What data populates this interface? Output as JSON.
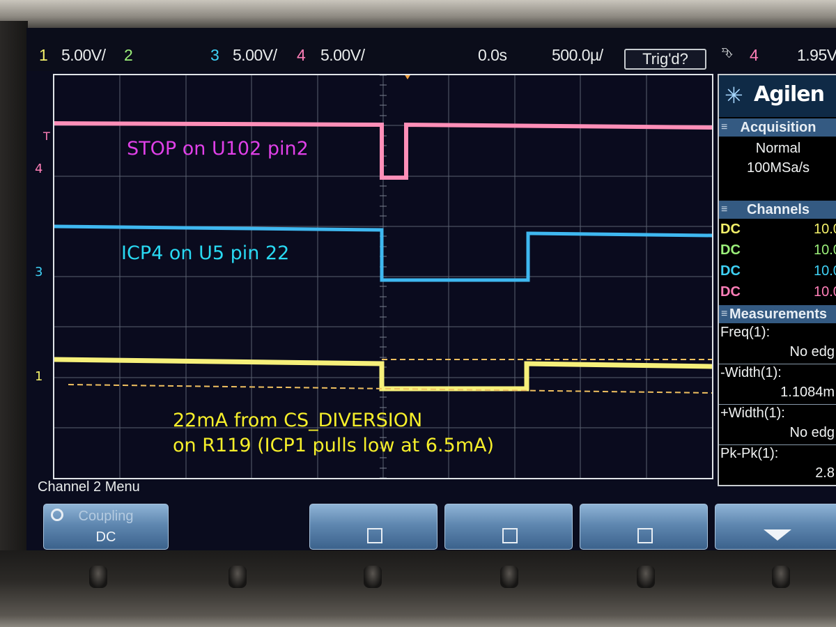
{
  "status_bar": {
    "ch1_num": "1",
    "ch1_scale": "5.00V/",
    "ch2_num": "2",
    "ch3_num": "3",
    "ch3_scale": "5.00V/",
    "ch4_num": "4",
    "ch4_scale": "5.00V/",
    "time_delay": "0.0s",
    "time_scale": "500.0µ/",
    "trigger_status": "Trig'd?",
    "trigger_source": "4",
    "trigger_level": "1.95V"
  },
  "traces": {
    "ch4_label": "4",
    "ch3_label": "3",
    "ch1_label": "1",
    "trigger_marker": "T"
  },
  "annotations": {
    "stop": "STOP on U102 pin2",
    "icp4": "ICP4 on U5 pin 22",
    "current_line1": "22mA from CS_DIVERSION",
    "current_line2": "on R119 (ICP1 pulls low at 6.5mA)"
  },
  "side_panel": {
    "brand": "Agilen",
    "acquisition_header": "Acquisition",
    "acquisition_mode": "Normal",
    "sample_rate": "100MSa/s",
    "channels_header": "Channels",
    "channels": [
      {
        "coupling": "DC",
        "scale": "10.0",
        "color": "#f4f16a"
      },
      {
        "coupling": "DC",
        "scale": "10.0",
        "color": "#9cf07a"
      },
      {
        "coupling": "DC",
        "scale": "10.0",
        "color": "#3fd1f5"
      },
      {
        "coupling": "DC",
        "scale": "10.0",
        "color": "#ff7fb8"
      }
    ],
    "measurements_header": "Measurements",
    "measurements": [
      {
        "label": "Freq(1):",
        "value": "No edg"
      },
      {
        "label": "-Width(1):",
        "value": "1.1084m"
      },
      {
        "label": "+Width(1):",
        "value": "No edg"
      },
      {
        "label": "Pk-Pk(1):",
        "value": "2.8"
      }
    ]
  },
  "menu": {
    "title": "Channel 2 Menu",
    "coupling_label": "Coupling",
    "coupling_value": "DC"
  },
  "colors": {
    "ch1": "#f4f16a",
    "ch2": "#9cf07a",
    "ch3": "#3fd1f5",
    "ch4": "#ff7fb8",
    "stop_text": "#e040e8",
    "icp4_text": "#29d9f2",
    "current_text": "#f6ef2a"
  }
}
